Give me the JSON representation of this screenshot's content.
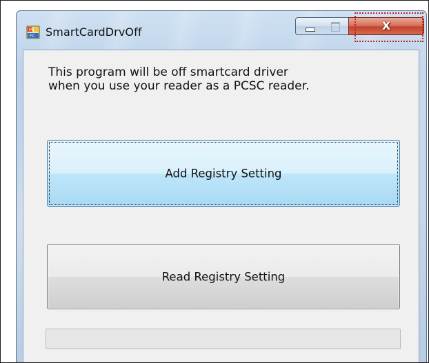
{
  "window": {
    "title": "SmartCardDrvOff",
    "app_icon": "smartcard-app-icon",
    "caption": {
      "minimize_icon": "minimize-icon",
      "maximize_icon": "maximize-icon",
      "close_icon": "close-icon",
      "close_glyph": "X"
    }
  },
  "content": {
    "description_line1": "This program will be off smartcard driver",
    "description_line2": "when you use your reader as a PCSC reader.",
    "add_button_label": "Add Registry Setting",
    "read_button_label": "Read Registry Setting",
    "progress": 0
  },
  "colors": {
    "focus_highlight": "#c81e1e",
    "add_button_accent": "#3c7fb1",
    "close_button": "#c4432c"
  }
}
